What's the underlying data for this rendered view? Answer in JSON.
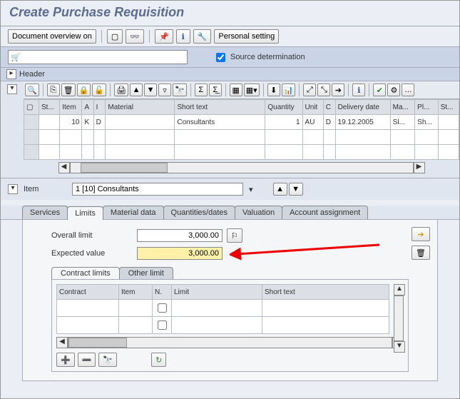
{
  "title": "Create Purchase Requisition",
  "main_toolbar": {
    "doc_overview": "Document overview on",
    "personal_setting": "Personal setting"
  },
  "sub_bar": {
    "source_det": "Source determination",
    "source_det_checked": true
  },
  "header_label": "Header",
  "grid": {
    "columns": [
      "St...",
      "Item",
      "A",
      "I",
      "Material",
      "Short text",
      "Quantity",
      "Unit",
      "C",
      "Delivery date",
      "Ma...",
      "Pl...",
      "St..."
    ],
    "rows": [
      {
        "st": "",
        "item": "10",
        "a": "K",
        "i": "D",
        "material": "",
        "short": "Consultants",
        "qty": "1",
        "unit": "AU",
        "c": "D",
        "ddate": "19.12.2005",
        "ma": "Sl...",
        "pl": "Sh...",
        "st2": ""
      },
      {
        "st": "",
        "item": "",
        "a": "",
        "i": "",
        "material": "",
        "short": "",
        "qty": "",
        "unit": "",
        "c": "",
        "ddate": "",
        "ma": "",
        "pl": "",
        "st2": ""
      },
      {
        "st": "",
        "item": "",
        "a": "",
        "i": "",
        "material": "",
        "short": "",
        "qty": "",
        "unit": "",
        "c": "",
        "ddate": "",
        "ma": "",
        "pl": "",
        "st2": ""
      }
    ]
  },
  "item_sel": {
    "label": "Item",
    "value": "1 [10] Consultants"
  },
  "tabs": [
    "Services",
    "Limits",
    "Material data",
    "Quantities/dates",
    "Valuation",
    "Account assignment"
  ],
  "active_tab": "Limits",
  "limits": {
    "overall_label": "Overall limit",
    "overall_value": "3,000.00",
    "expected_label": "Expected value",
    "expected_value": "3,000.00"
  },
  "subtabs": [
    "Contract limits",
    "Other limit"
  ],
  "active_subtab": "Contract limits",
  "subgrid": {
    "columns": [
      "Contract",
      "Item",
      "N.",
      "Limit",
      "Short text"
    ],
    "rows": [
      {
        "contract": "",
        "item": "",
        "n": "",
        "limit": "",
        "short": ""
      },
      {
        "contract": "",
        "item": "",
        "n": "",
        "limit": "",
        "short": ""
      }
    ]
  }
}
